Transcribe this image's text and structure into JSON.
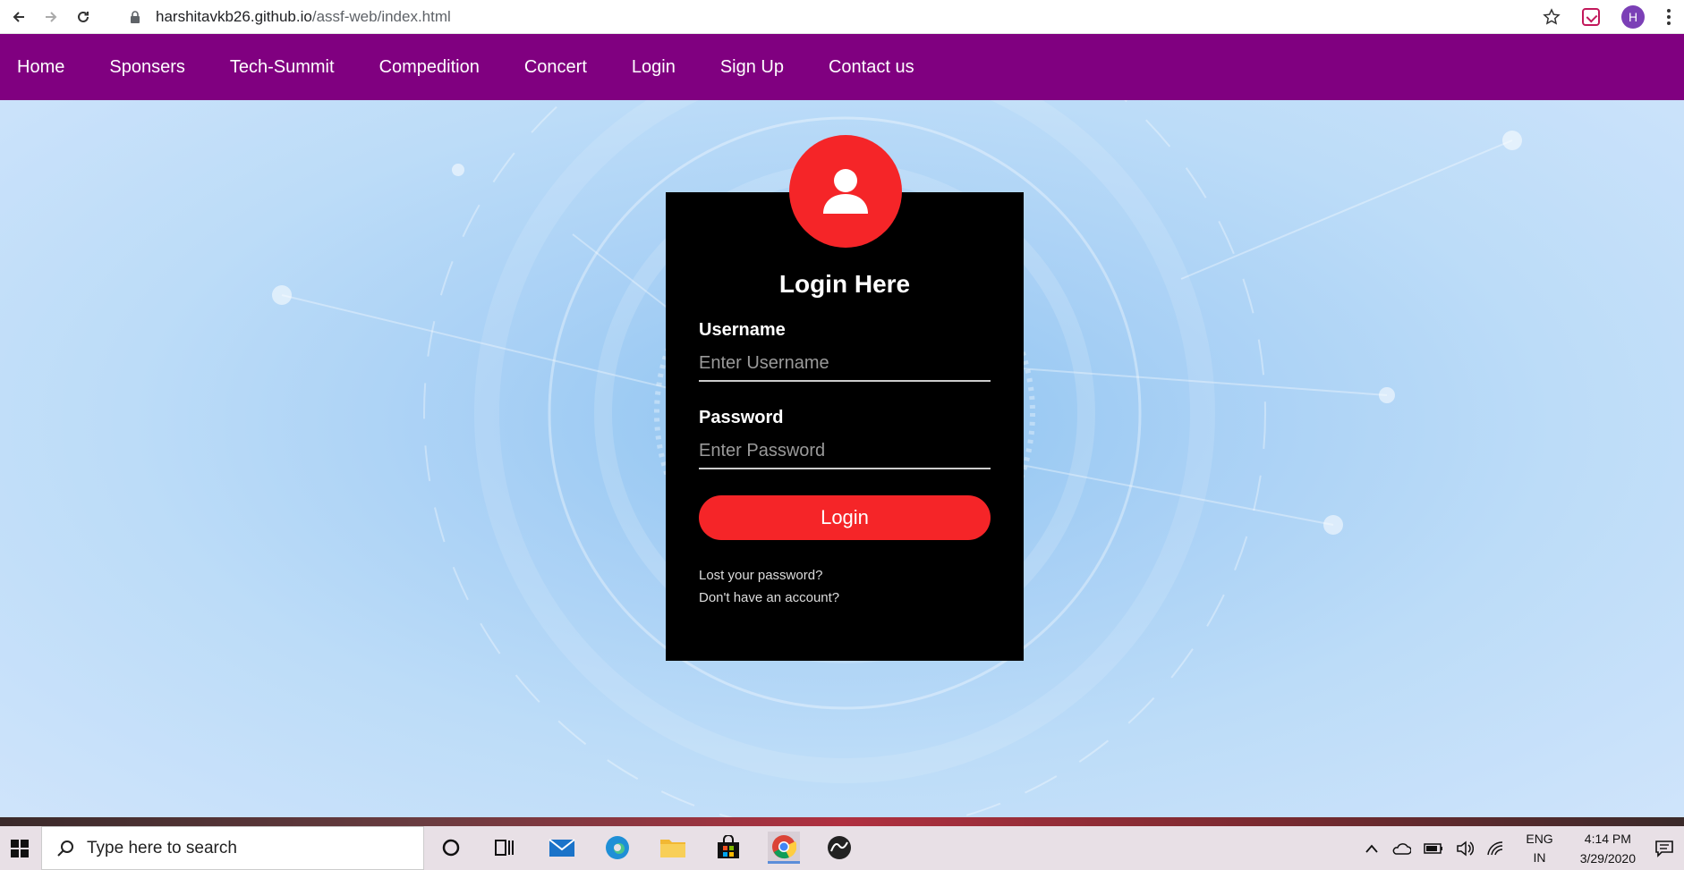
{
  "browser": {
    "url_host": "harshitavkb26.github.io",
    "url_path": "/assf-web/index.html",
    "profile_initial": "H"
  },
  "nav": {
    "items": [
      "Home",
      "Sponsers",
      "Tech-Summit",
      "Compedition",
      "Concert",
      "Login",
      "Sign Up",
      "Contact us"
    ]
  },
  "login": {
    "title": "Login Here",
    "username_label": "Username",
    "username_placeholder": "Enter Username",
    "password_label": "Password",
    "password_placeholder": "Enter Password",
    "button_label": "Login",
    "lost_password": "Lost your password?",
    "no_account": "Don't have an account?"
  },
  "taskbar": {
    "search_placeholder": "Type here to search",
    "lang_line1": "ENG",
    "lang_line2": "IN",
    "time": "4:14 PM",
    "date": "3/29/2020"
  },
  "colors": {
    "nav_bg": "#800080",
    "accent_red": "#f52528",
    "card_bg": "#000000"
  }
}
